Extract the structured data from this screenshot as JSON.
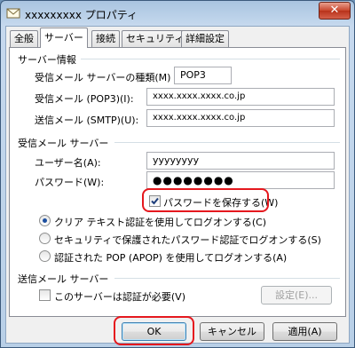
{
  "window": {
    "title": "xxxxxxxxx プロパティ",
    "close_glyph": "✕"
  },
  "tabs": [
    {
      "label": "全般",
      "active": false
    },
    {
      "label": "サーバー",
      "active": true
    },
    {
      "label": "接続",
      "active": false
    },
    {
      "label": "セキュリティ",
      "active": false
    },
    {
      "label": "詳細設定",
      "active": false
    }
  ],
  "server_info": {
    "heading": "サーバー情報",
    "incoming_type_label": "受信メール サーバーの種類(M)",
    "incoming_type_value": "POP3",
    "incoming_label": "受信メール (POP3)(I):",
    "incoming_value": "xxxx.xxxx.xxxx.co.jp",
    "outgoing_label": "送信メール (SMTP)(U):",
    "outgoing_value": "xxxx.xxxx.xxxx.co.jp"
  },
  "incoming_server": {
    "heading": "受信メール サーバー",
    "username_label": "ユーザー名(A):",
    "username_value": "yyyyyyyy",
    "password_label": "パスワード(W):",
    "password_value": "●●●●●●●●",
    "remember_label": "パスワードを保存する(W)",
    "remember_checked": true,
    "auth_options": [
      {
        "label": "クリア テキスト認証を使用してログオンする(C)",
        "selected": true
      },
      {
        "label": "セキュリティで保護されたパスワード認証でログオンする(S)",
        "selected": false
      },
      {
        "label": "認証された POP (APOP) を使用してログオンする(A)",
        "selected": false
      }
    ]
  },
  "outgoing_server": {
    "heading": "送信メール サーバー",
    "auth_required_label": "このサーバーは認証が必要(V)",
    "auth_required_checked": false,
    "settings_button": "設定(E)..."
  },
  "footer": {
    "ok": "OK",
    "cancel": "キャンセル",
    "apply": "適用(A)"
  },
  "colors": {
    "highlight": "#e5181e",
    "accent": "#1c4fa0"
  },
  "icons": {
    "title": "envelope-icon",
    "check": "checkmark-icon"
  }
}
